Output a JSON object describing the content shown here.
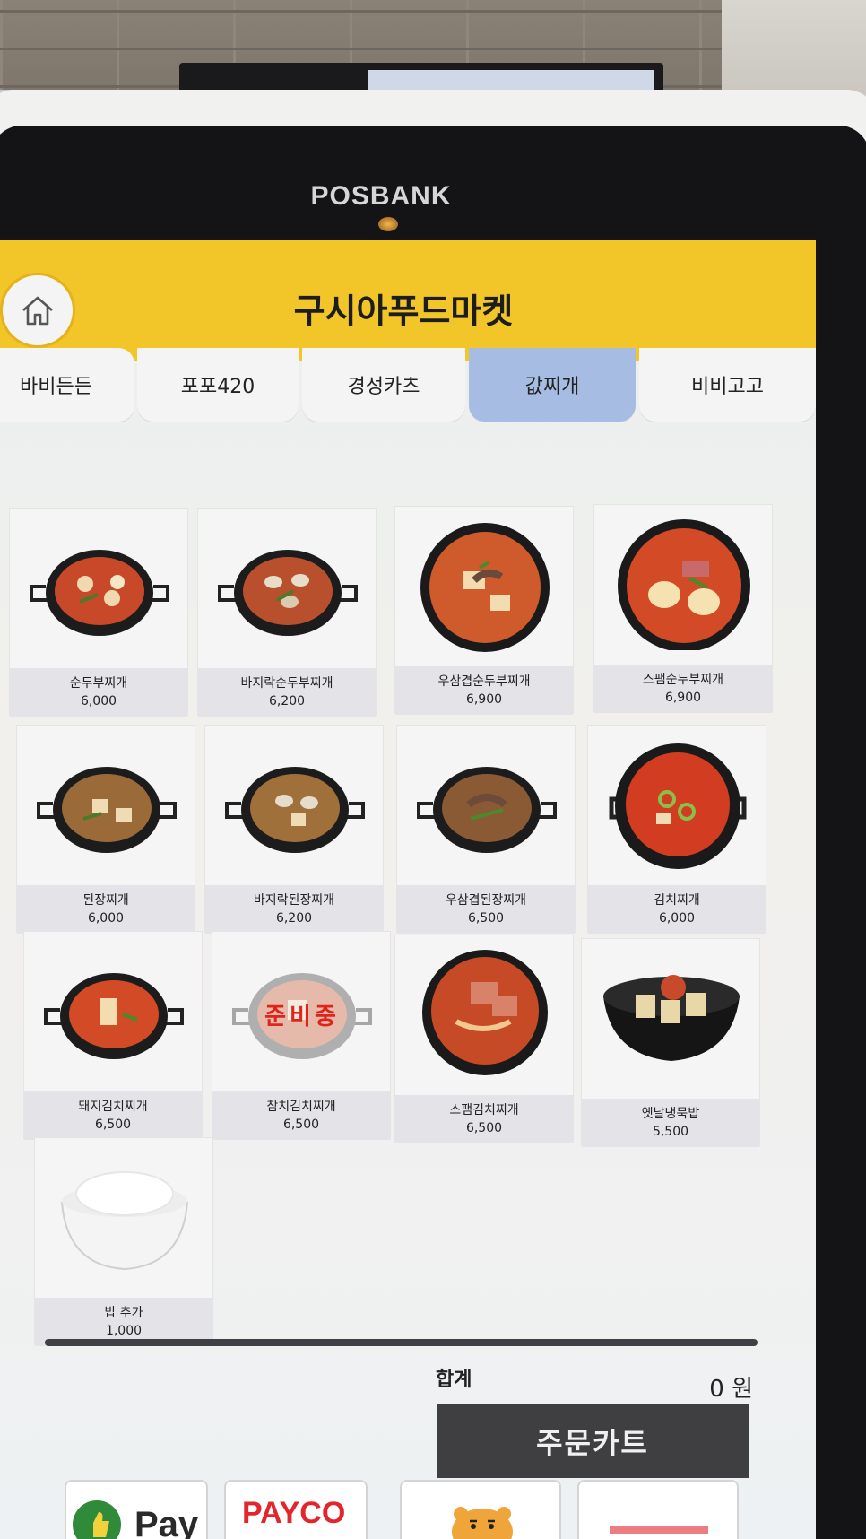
{
  "device": {
    "brand": "POSBANK"
  },
  "header": {
    "title": "구시아푸드마켓",
    "home_icon": "home-icon"
  },
  "tabs": [
    {
      "label": "바비든든",
      "active": false
    },
    {
      "label": "포포420",
      "active": false
    },
    {
      "label": "경성카츠",
      "active": false
    },
    {
      "label": "값찌개",
      "active": true
    },
    {
      "label": "비비고고",
      "active": false
    }
  ],
  "menu": [
    {
      "name": "순두부찌개",
      "price": "6,000",
      "sold_out": false
    },
    {
      "name": "바지락순두부찌개",
      "price": "6,200",
      "sold_out": false
    },
    {
      "name": "우삼겹순두부찌개",
      "price": "6,900",
      "sold_out": false
    },
    {
      "name": "스팸순두부찌개",
      "price": "6,900",
      "sold_out": false
    },
    {
      "name": "된장찌개",
      "price": "6,000",
      "sold_out": false
    },
    {
      "name": "바지락된장찌개",
      "price": "6,200",
      "sold_out": false
    },
    {
      "name": "우삼겹된장찌개",
      "price": "6,500",
      "sold_out": false
    },
    {
      "name": "김치찌개",
      "price": "6,000",
      "sold_out": false
    },
    {
      "name": "돼지김치찌개",
      "price": "6,500",
      "sold_out": false
    },
    {
      "name": "참치김치찌개",
      "price": "6,500",
      "sold_out": true,
      "badge": "준비중"
    },
    {
      "name": "스팸김치찌개",
      "price": "6,500",
      "sold_out": false
    },
    {
      "name": "옛날냉묵밥",
      "price": "5,500",
      "sold_out": false
    },
    {
      "name": "밥 추가",
      "price": "1,000",
      "sold_out": false
    }
  ],
  "summary": {
    "total_label": "합계",
    "total_value": "0 원",
    "cart_button": "주문카트"
  },
  "payments": [
    {
      "label": "Pay",
      "icon": "thumbs-up-icon",
      "color": "#2a2a2a"
    },
    {
      "label": "PAYCO",
      "icon": "",
      "color": "#e3262e"
    },
    {
      "label": "",
      "icon": "kakao-ryan-icon",
      "color": "#f7d23c"
    },
    {
      "label": "",
      "icon": "",
      "color": "#e3262e"
    }
  ],
  "colors": {
    "header": "#f2c529",
    "active_tab": "#a6bce3",
    "cart_button": "#3f3f41",
    "sold_out": "#e0241c"
  }
}
